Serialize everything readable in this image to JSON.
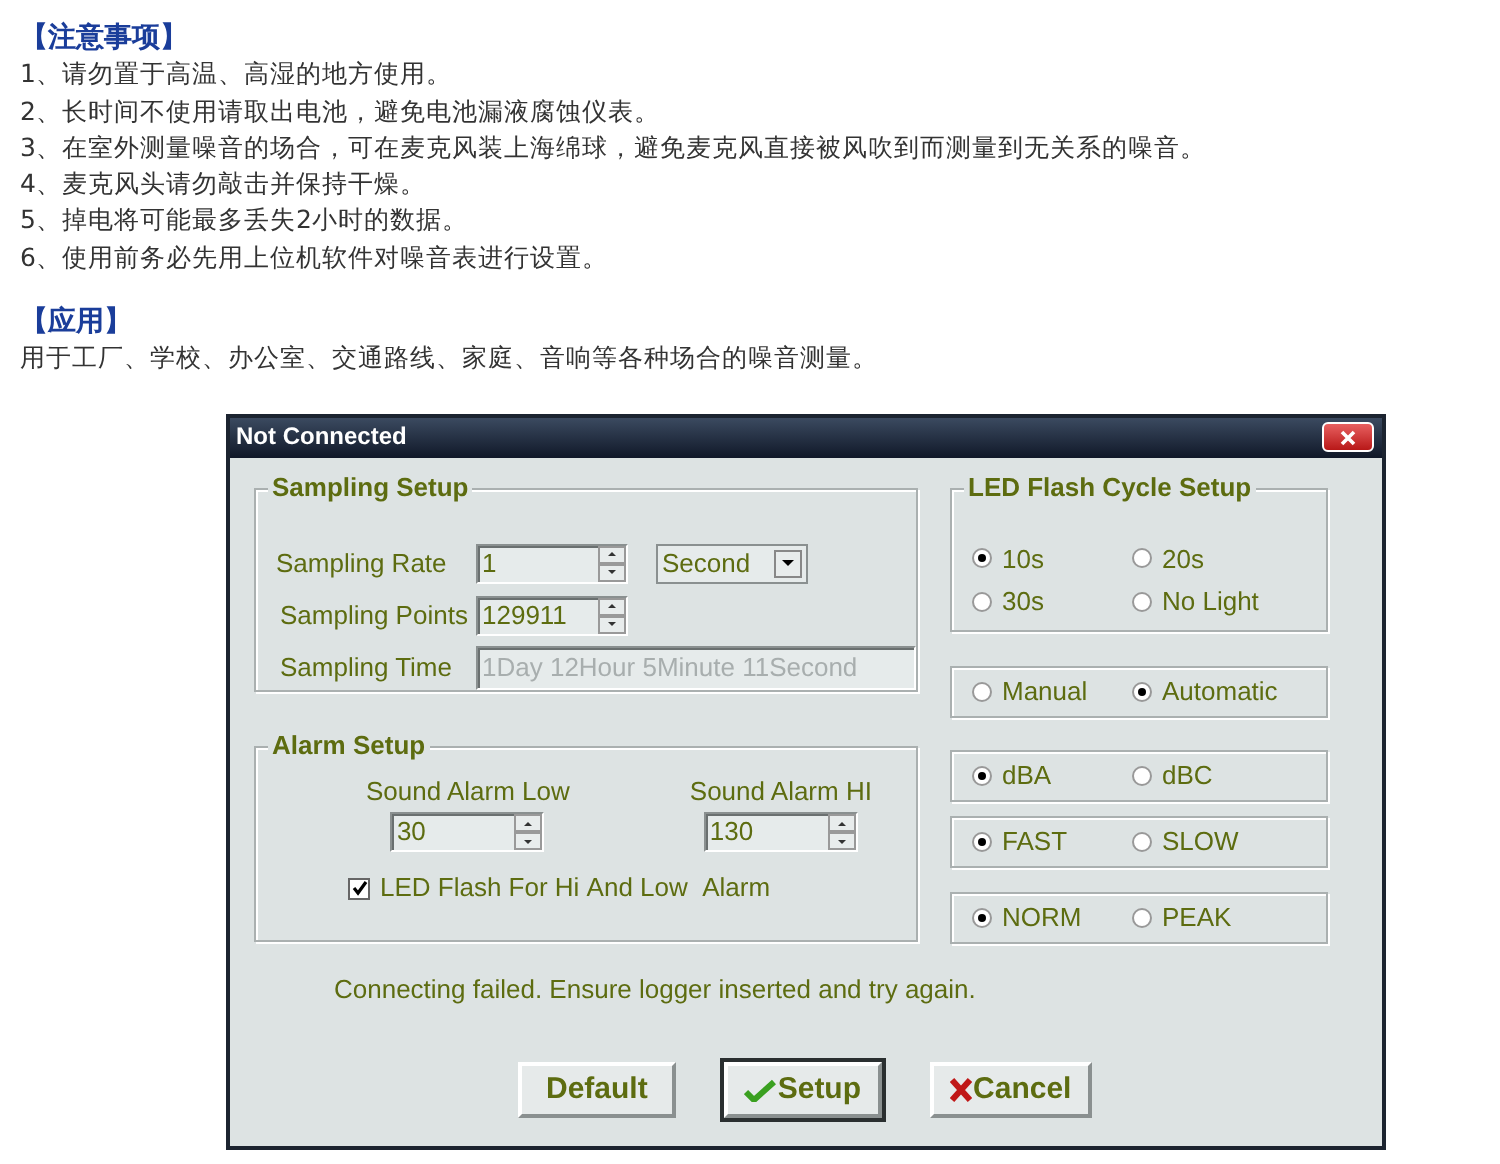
{
  "notes": {
    "title": "【注意事项】",
    "items": [
      "1、请勿置于高温、高湿的地方使用。",
      "2、长时间不使用请取出电池，避免电池漏液腐蚀仪表。",
      "3、在室外测量噪音的场合，可在麦克风装上海绵球，避免麦克风直接被风吹到而测量到无关系的噪音。",
      "4、麦克风头请勿敲击并保持干燥。",
      "5、掉电将可能最多丢失2小时的数据。",
      "6、使用前务必先用上位机软件对噪音表进行设置。"
    ]
  },
  "application": {
    "title": "【应用】",
    "text": "用于工厂、学校、办公室、交通路线、家庭、音响等各种场合的噪音测量。"
  },
  "dialog": {
    "title": "Not Connected",
    "sampling": {
      "title": "Sampling Setup",
      "rate_label": "Sampling Rate",
      "rate_value": "1",
      "rate_unit": "Second",
      "points_label": "Sampling Points",
      "points_value": "129911",
      "time_label": "Sampling Time",
      "time_value": "1Day 12Hour 5Minute 11Second",
      "time_disabled": true
    },
    "alarm": {
      "title": "Alarm Setup",
      "low_label": "Sound Alarm Low",
      "low_value": "30",
      "hi_label": "Sound Alarm HI",
      "hi_value": "130",
      "led_flash": {
        "label": "LED Flash For Hi And Low  Alarm",
        "checked": true
      }
    },
    "led_cycle": {
      "title": "LED Flash Cycle Setup",
      "options": [
        {
          "label": "10s",
          "selected": true
        },
        {
          "label": "20s",
          "selected": false
        },
        {
          "label": "30s",
          "selected": false
        },
        {
          "label": "No Light",
          "selected": false
        }
      ]
    },
    "radio_groups": [
      {
        "options": [
          {
            "label": "Manual",
            "selected": false
          },
          {
            "label": "Automatic",
            "selected": true
          }
        ]
      },
      {
        "options": [
          {
            "label": "dBA",
            "selected": true
          },
          {
            "label": "dBC",
            "selected": false
          }
        ]
      },
      {
        "options": [
          {
            "label": "FAST",
            "selected": true
          },
          {
            "label": "SLOW",
            "selected": false
          }
        ]
      },
      {
        "options": [
          {
            "label": "NORM",
            "selected": true
          },
          {
            "label": "PEAK",
            "selected": false
          }
        ]
      }
    ],
    "status": "Connecting failed. Ensure logger inserted and try again.",
    "buttons": [
      {
        "label": "Default",
        "kind": "plain",
        "focused": false
      },
      {
        "label": "Setup",
        "kind": "confirm",
        "focused": true
      },
      {
        "label": "Cancel",
        "kind": "cancel",
        "focused": false
      }
    ]
  }
}
